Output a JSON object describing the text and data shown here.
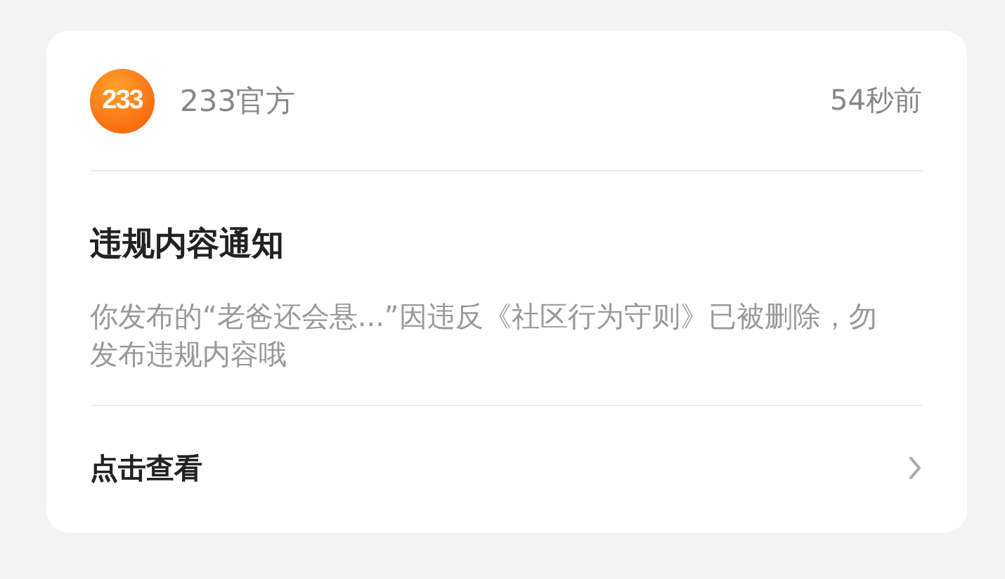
{
  "header": {
    "logo_text": "233",
    "sender": "233官方",
    "time": "54秒前"
  },
  "title": "违规内容通知",
  "body": "你发布的“老爸还会悬...”因违反《社区行为守则》已被删除，勿发布违规内容哦",
  "footer": {
    "link": "点击查看"
  }
}
